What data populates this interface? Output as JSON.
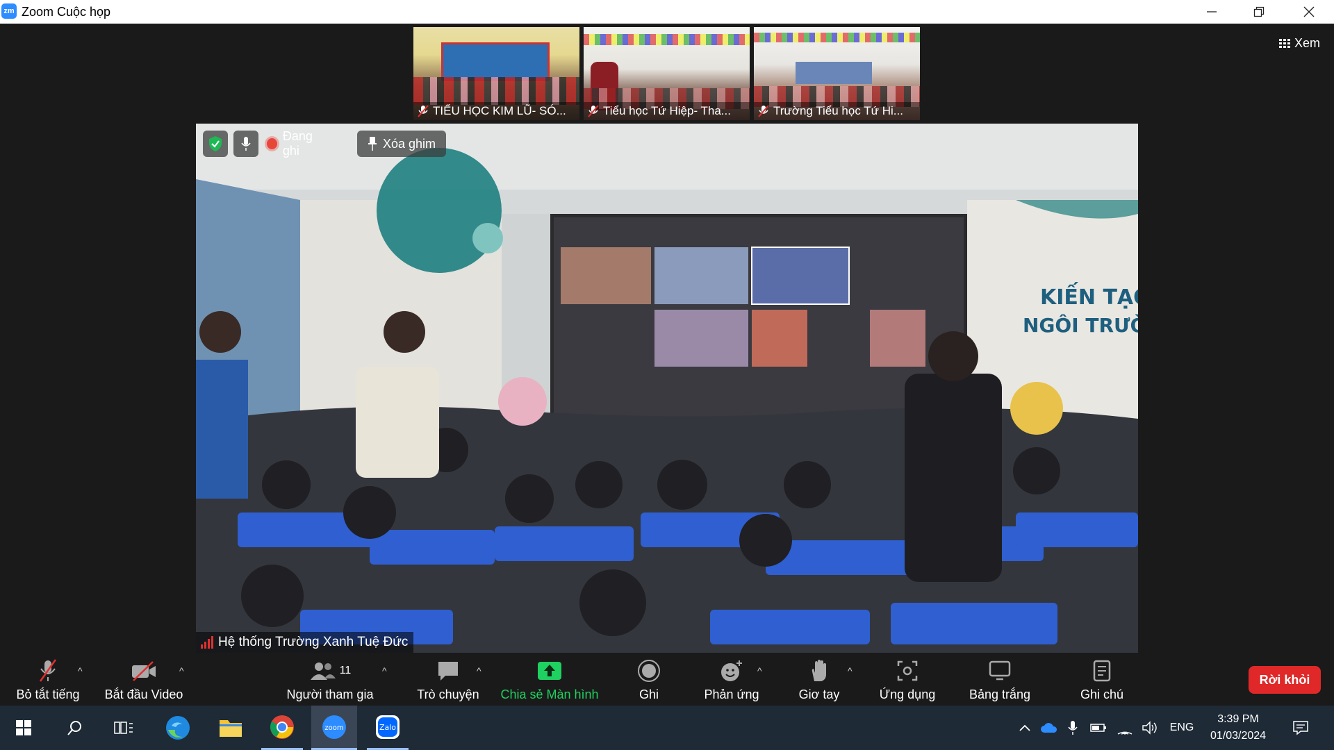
{
  "window": {
    "app_icon": "zoom-logo",
    "title": "Zoom Cuộc họp",
    "logo_text": "zm"
  },
  "view_button": {
    "label": "Xem",
    "icon": "grid-icon"
  },
  "thumbnails": [
    {
      "name": "TIỂU HỌC KIM LŨ- SÓ..."
    },
    {
      "name": "Tiểu học Tứ Hiệp- Tha..."
    },
    {
      "name": "Trường Tiểu học Tứ Hi..."
    }
  ],
  "main_video": {
    "recording_label": "Đang ghi",
    "unpin_label": "Xóa ghim",
    "speaker_name": "Hệ thống Trường Xanh Tuệ Đức"
  },
  "toolbar": {
    "mute_label": "Bỏ tắt tiếng",
    "video_label": "Bắt đầu Video",
    "participants_label": "Người tham gia",
    "participants_count": "11",
    "chat_label": "Trò chuyện",
    "share_label": "Chia sẻ Màn hình",
    "record_label": "Ghi",
    "reactions_label": "Phản ứng",
    "raise_hand_label": "Giơ tay",
    "apps_label": "Ứng dụng",
    "whiteboard_label": "Bảng trắng",
    "notes_label": "Ghi chú",
    "leave_label": "Rời khỏi",
    "share_color": "#1fd160",
    "leave_color": "#e02828"
  },
  "taskbar": {
    "language": "ENG",
    "time": "3:39 PM",
    "date": "01/03/2024"
  }
}
